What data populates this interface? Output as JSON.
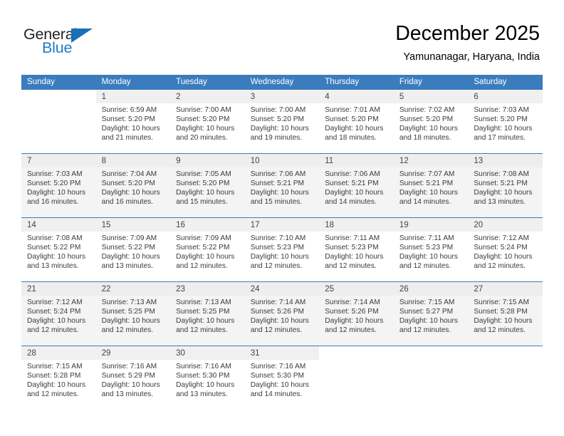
{
  "brand": {
    "name_top": "General",
    "name_bottom": "Blue",
    "color_dark": "#231f20",
    "color_blue": "#1d7cc4"
  },
  "header": {
    "title": "December 2025",
    "subtitle": "Yamunanagar, Haryana, India"
  },
  "theme": {
    "header_row_bg": "#3a7cbe",
    "header_row_text": "#ffffff",
    "alt_row_bg": "#f4f4f4"
  },
  "weekday_headers": [
    "Sunday",
    "Monday",
    "Tuesday",
    "Wednesday",
    "Thursday",
    "Friday",
    "Saturday"
  ],
  "weeks": [
    [
      {
        "day": "",
        "sunrise": "",
        "sunset": "",
        "daylight_a": "",
        "daylight_b": ""
      },
      {
        "day": "1",
        "sunrise": "Sunrise: 6:59 AM",
        "sunset": "Sunset: 5:20 PM",
        "daylight_a": "Daylight: 10 hours",
        "daylight_b": "and 21 minutes."
      },
      {
        "day": "2",
        "sunrise": "Sunrise: 7:00 AM",
        "sunset": "Sunset: 5:20 PM",
        "daylight_a": "Daylight: 10 hours",
        "daylight_b": "and 20 minutes."
      },
      {
        "day": "3",
        "sunrise": "Sunrise: 7:00 AM",
        "sunset": "Sunset: 5:20 PM",
        "daylight_a": "Daylight: 10 hours",
        "daylight_b": "and 19 minutes."
      },
      {
        "day": "4",
        "sunrise": "Sunrise: 7:01 AM",
        "sunset": "Sunset: 5:20 PM",
        "daylight_a": "Daylight: 10 hours",
        "daylight_b": "and 18 minutes."
      },
      {
        "day": "5",
        "sunrise": "Sunrise: 7:02 AM",
        "sunset": "Sunset: 5:20 PM",
        "daylight_a": "Daylight: 10 hours",
        "daylight_b": "and 18 minutes."
      },
      {
        "day": "6",
        "sunrise": "Sunrise: 7:03 AM",
        "sunset": "Sunset: 5:20 PM",
        "daylight_a": "Daylight: 10 hours",
        "daylight_b": "and 17 minutes."
      }
    ],
    [
      {
        "day": "7",
        "sunrise": "Sunrise: 7:03 AM",
        "sunset": "Sunset: 5:20 PM",
        "daylight_a": "Daylight: 10 hours",
        "daylight_b": "and 16 minutes."
      },
      {
        "day": "8",
        "sunrise": "Sunrise: 7:04 AM",
        "sunset": "Sunset: 5:20 PM",
        "daylight_a": "Daylight: 10 hours",
        "daylight_b": "and 16 minutes."
      },
      {
        "day": "9",
        "sunrise": "Sunrise: 7:05 AM",
        "sunset": "Sunset: 5:20 PM",
        "daylight_a": "Daylight: 10 hours",
        "daylight_b": "and 15 minutes."
      },
      {
        "day": "10",
        "sunrise": "Sunrise: 7:06 AM",
        "sunset": "Sunset: 5:21 PM",
        "daylight_a": "Daylight: 10 hours",
        "daylight_b": "and 15 minutes."
      },
      {
        "day": "11",
        "sunrise": "Sunrise: 7:06 AM",
        "sunset": "Sunset: 5:21 PM",
        "daylight_a": "Daylight: 10 hours",
        "daylight_b": "and 14 minutes."
      },
      {
        "day": "12",
        "sunrise": "Sunrise: 7:07 AM",
        "sunset": "Sunset: 5:21 PM",
        "daylight_a": "Daylight: 10 hours",
        "daylight_b": "and 14 minutes."
      },
      {
        "day": "13",
        "sunrise": "Sunrise: 7:08 AM",
        "sunset": "Sunset: 5:21 PM",
        "daylight_a": "Daylight: 10 hours",
        "daylight_b": "and 13 minutes."
      }
    ],
    [
      {
        "day": "14",
        "sunrise": "Sunrise: 7:08 AM",
        "sunset": "Sunset: 5:22 PM",
        "daylight_a": "Daylight: 10 hours",
        "daylight_b": "and 13 minutes."
      },
      {
        "day": "15",
        "sunrise": "Sunrise: 7:09 AM",
        "sunset": "Sunset: 5:22 PM",
        "daylight_a": "Daylight: 10 hours",
        "daylight_b": "and 13 minutes."
      },
      {
        "day": "16",
        "sunrise": "Sunrise: 7:09 AM",
        "sunset": "Sunset: 5:22 PM",
        "daylight_a": "Daylight: 10 hours",
        "daylight_b": "and 12 minutes."
      },
      {
        "day": "17",
        "sunrise": "Sunrise: 7:10 AM",
        "sunset": "Sunset: 5:23 PM",
        "daylight_a": "Daylight: 10 hours",
        "daylight_b": "and 12 minutes."
      },
      {
        "day": "18",
        "sunrise": "Sunrise: 7:11 AM",
        "sunset": "Sunset: 5:23 PM",
        "daylight_a": "Daylight: 10 hours",
        "daylight_b": "and 12 minutes."
      },
      {
        "day": "19",
        "sunrise": "Sunrise: 7:11 AM",
        "sunset": "Sunset: 5:23 PM",
        "daylight_a": "Daylight: 10 hours",
        "daylight_b": "and 12 minutes."
      },
      {
        "day": "20",
        "sunrise": "Sunrise: 7:12 AM",
        "sunset": "Sunset: 5:24 PM",
        "daylight_a": "Daylight: 10 hours",
        "daylight_b": "and 12 minutes."
      }
    ],
    [
      {
        "day": "21",
        "sunrise": "Sunrise: 7:12 AM",
        "sunset": "Sunset: 5:24 PM",
        "daylight_a": "Daylight: 10 hours",
        "daylight_b": "and 12 minutes."
      },
      {
        "day": "22",
        "sunrise": "Sunrise: 7:13 AM",
        "sunset": "Sunset: 5:25 PM",
        "daylight_a": "Daylight: 10 hours",
        "daylight_b": "and 12 minutes."
      },
      {
        "day": "23",
        "sunrise": "Sunrise: 7:13 AM",
        "sunset": "Sunset: 5:25 PM",
        "daylight_a": "Daylight: 10 hours",
        "daylight_b": "and 12 minutes."
      },
      {
        "day": "24",
        "sunrise": "Sunrise: 7:14 AM",
        "sunset": "Sunset: 5:26 PM",
        "daylight_a": "Daylight: 10 hours",
        "daylight_b": "and 12 minutes."
      },
      {
        "day": "25",
        "sunrise": "Sunrise: 7:14 AM",
        "sunset": "Sunset: 5:26 PM",
        "daylight_a": "Daylight: 10 hours",
        "daylight_b": "and 12 minutes."
      },
      {
        "day": "26",
        "sunrise": "Sunrise: 7:15 AM",
        "sunset": "Sunset: 5:27 PM",
        "daylight_a": "Daylight: 10 hours",
        "daylight_b": "and 12 minutes."
      },
      {
        "day": "27",
        "sunrise": "Sunrise: 7:15 AM",
        "sunset": "Sunset: 5:28 PM",
        "daylight_a": "Daylight: 10 hours",
        "daylight_b": "and 12 minutes."
      }
    ],
    [
      {
        "day": "28",
        "sunrise": "Sunrise: 7:15 AM",
        "sunset": "Sunset: 5:28 PM",
        "daylight_a": "Daylight: 10 hours",
        "daylight_b": "and 12 minutes."
      },
      {
        "day": "29",
        "sunrise": "Sunrise: 7:16 AM",
        "sunset": "Sunset: 5:29 PM",
        "daylight_a": "Daylight: 10 hours",
        "daylight_b": "and 13 minutes."
      },
      {
        "day": "30",
        "sunrise": "Sunrise: 7:16 AM",
        "sunset": "Sunset: 5:30 PM",
        "daylight_a": "Daylight: 10 hours",
        "daylight_b": "and 13 minutes."
      },
      {
        "day": "31",
        "sunrise": "Sunrise: 7:16 AM",
        "sunset": "Sunset: 5:30 PM",
        "daylight_a": "Daylight: 10 hours",
        "daylight_b": "and 14 minutes."
      },
      {
        "day": "",
        "sunrise": "",
        "sunset": "",
        "daylight_a": "",
        "daylight_b": ""
      },
      {
        "day": "",
        "sunrise": "",
        "sunset": "",
        "daylight_a": "",
        "daylight_b": ""
      },
      {
        "day": "",
        "sunrise": "",
        "sunset": "",
        "daylight_a": "",
        "daylight_b": ""
      }
    ]
  ]
}
